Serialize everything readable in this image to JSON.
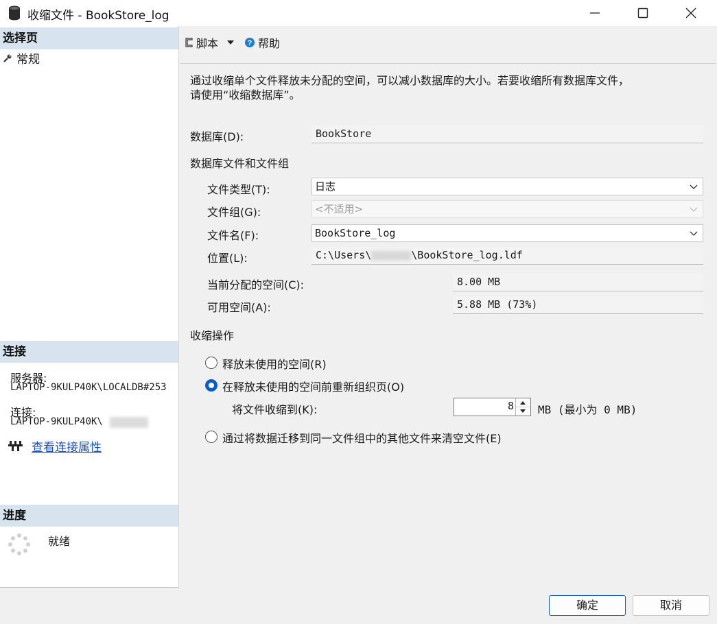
{
  "window": {
    "title": "收缩文件 - BookStore_log"
  },
  "left": {
    "select_page_header": "选择页",
    "pages": [
      {
        "label": "常规",
        "icon": "wrench-icon"
      }
    ],
    "connection_header": "连接",
    "server_label": "服务器:",
    "server_value": "LAPTOP-9KULP40K\\LOCALDB#253",
    "connection_label": "连接:",
    "connection_value": "LAPTOP-9KULP40K\\",
    "view_connection_link": "查看连接属性",
    "progress_header": "进度",
    "progress_status": "就绪"
  },
  "toolbar": {
    "script_label": "脚本",
    "help_label": "帮助"
  },
  "main": {
    "description_line1": "通过收缩单个文件释放未分配的空间，可以减小数据库的大小。若要收缩所有数据库文件，",
    "description_line2": "请使用“收缩数据库”。",
    "database_label": "数据库(D):",
    "database_value": "BookStore",
    "files_group_header": "数据库文件和文件组",
    "file_type_label": "文件类型(T):",
    "file_type_value": "日志",
    "filegroup_label": "文件组(G):",
    "filegroup_value": "<不适用>",
    "filename_label": "文件名(F):",
    "filename_value": "BookStore_log",
    "location_label": "位置(L):",
    "location_prefix": "C:\\Users\\",
    "location_suffix": "\\BookStore_log.ldf",
    "allocated_label": "当前分配的空间(C):",
    "allocated_value": "8.00 MB",
    "available_label": "可用空间(A):",
    "available_value": "5.88 MB (73%)",
    "shrink_header": "收缩操作",
    "option_release": "释放未使用的空间(R)",
    "option_reorganize": "在释放未使用的空间前重新组织页(O)",
    "shrink_to_label": "将文件收缩到(K):",
    "shrink_to_value": "8",
    "shrink_to_unit": "MB (最小为 0 MB)",
    "option_empty": "通过将数据迁移到同一文件组中的其他文件来清空文件(E)",
    "selected_option": "reorganize"
  },
  "footer": {
    "ok_label": "确定",
    "cancel_label": "取消"
  },
  "colors": {
    "accent": "#0a5fc4",
    "section_header_bg": "#d7e3ee",
    "link": "#1a4fc4"
  }
}
